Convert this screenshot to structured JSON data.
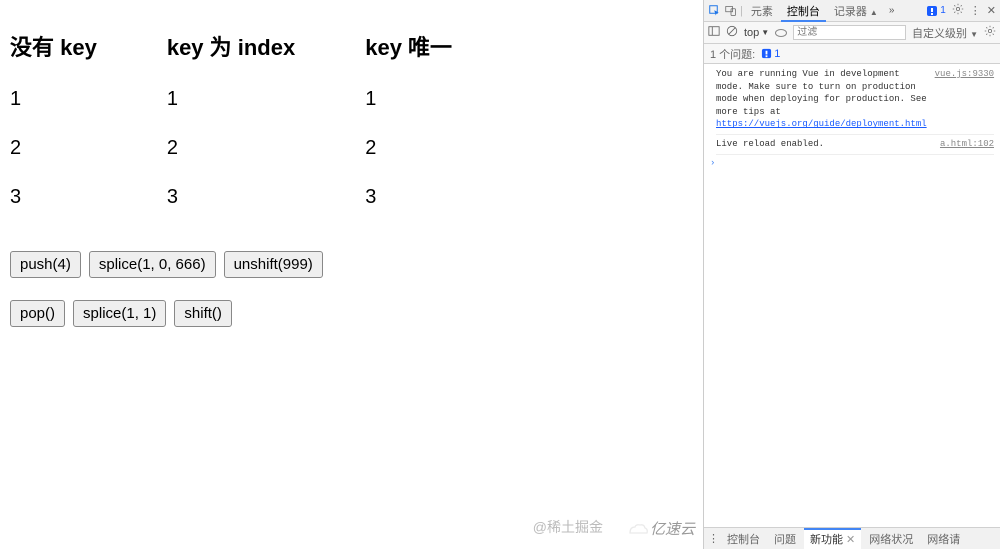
{
  "columns": [
    {
      "title": "没有 key",
      "items": [
        "1",
        "2",
        "3"
      ]
    },
    {
      "title": "key 为 index",
      "items": [
        "1",
        "2",
        "3"
      ]
    },
    {
      "title": "key 唯一",
      "items": [
        "1",
        "2",
        "3"
      ]
    }
  ],
  "buttons_row1": [
    {
      "name": "push-button",
      "label": "push(4)"
    },
    {
      "name": "splice-insert-button",
      "label": "splice(1, 0, 666)"
    },
    {
      "name": "unshift-button",
      "label": "unshift(999)"
    }
  ],
  "buttons_row2": [
    {
      "name": "pop-button",
      "label": "pop()"
    },
    {
      "name": "splice-remove-button",
      "label": "splice(1, 1)"
    },
    {
      "name": "shift-button",
      "label": "shift()"
    }
  ],
  "watermark1": "@稀土掘金",
  "watermark2": "亿速云",
  "devtools": {
    "top_tabs": {
      "elements": "元素",
      "console": "控制台",
      "recorder": "记录器",
      "more": "»"
    },
    "badge_count": "1",
    "toolbar": {
      "context": "top",
      "filter_placeholder": "过滤",
      "level": "自定义级别"
    },
    "issues": {
      "label": "1 个问题:",
      "count": "1"
    },
    "console_lines": [
      {
        "msg": "You are running Vue in development mode.\nMake sure to turn on production mode when deploying for production.\nSee more tips at ",
        "link": "https://vuejs.org/guide/deployment.html",
        "src": "vue.js:9330"
      },
      {
        "msg": "Live reload enabled.",
        "src": "a.html:102"
      }
    ],
    "bottom_tabs": {
      "menu": "⋮",
      "console": "控制台",
      "issues": "问题",
      "whatsnew": "新功能",
      "network": "网络状况",
      "network2": "网络请"
    }
  }
}
